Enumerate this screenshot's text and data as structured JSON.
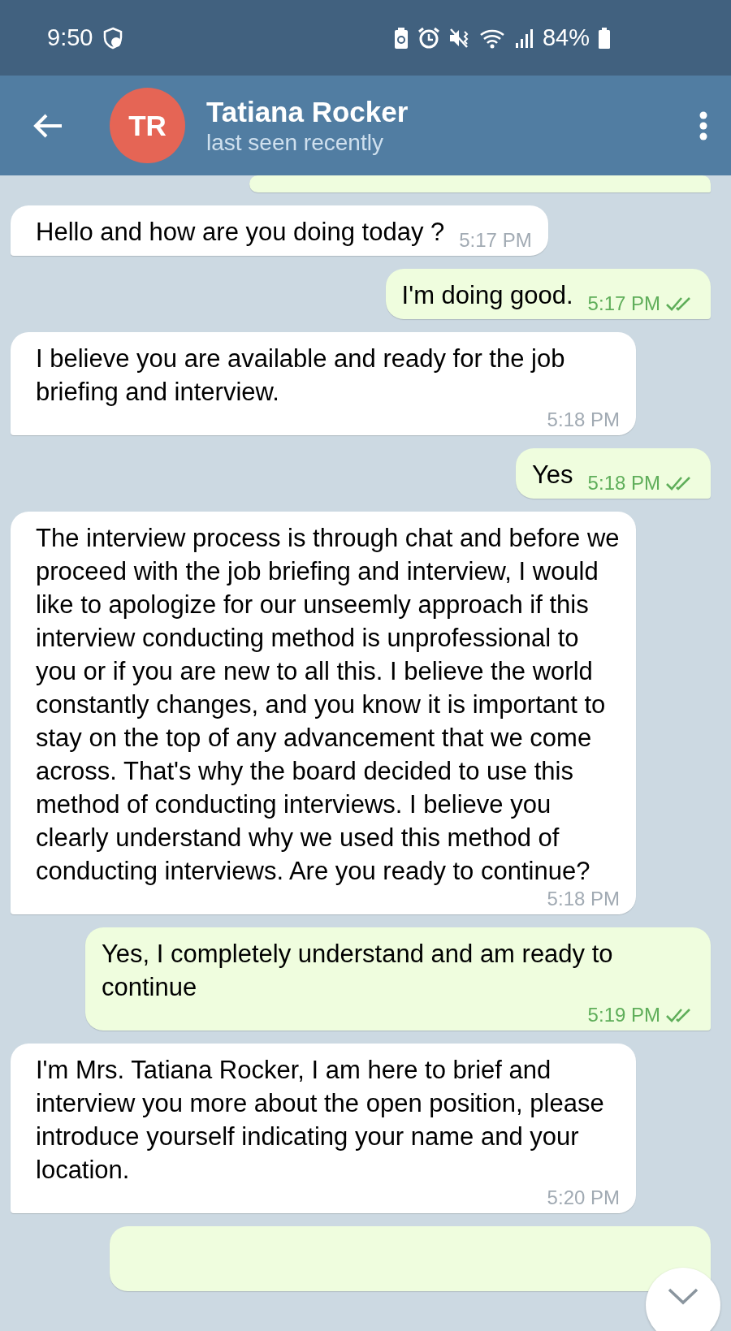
{
  "status_bar": {
    "time": "9:50",
    "battery": "84%"
  },
  "header": {
    "avatar_initials": "TR",
    "name": "Tatiana Rocker",
    "status": "last seen recently"
  },
  "messages": [
    {
      "kind": "incoming",
      "text": "Hello and how are you doing today ?",
      "time": "5:17 PM"
    },
    {
      "kind": "outgoing",
      "text": "I'm doing good.",
      "time": "5:17 PM",
      "read": true
    },
    {
      "kind": "incoming",
      "text": "I believe you are available and ready for the job briefing and interview.",
      "time": "5:18 PM"
    },
    {
      "kind": "outgoing",
      "text": "Yes",
      "time": "5:18 PM",
      "read": true
    },
    {
      "kind": "incoming",
      "text": "The interview process is through chat and before we proceed with the job briefing and interview, I would like to apologize for our unseemly approach if this interview conducting method is unprofessional to you or if you are new to all this. I believe the world constantly changes, and you know it is important to stay on the top of any advancement that we come across. That's why the board decided to use this method of conducting interviews. I believe you clearly understand why we used this method of conducting interviews. Are you ready to continue?",
      "time": "5:18 PM"
    },
    {
      "kind": "outgoing",
      "text": "Yes, I completely understand and am ready to continue",
      "time": "5:19 PM",
      "read": true
    },
    {
      "kind": "incoming",
      "text": "I'm Mrs. Tatiana Rocker, I am here to brief and interview you more about the open position, please introduce yourself indicating your name and your location.",
      "time": "5:20 PM"
    }
  ]
}
